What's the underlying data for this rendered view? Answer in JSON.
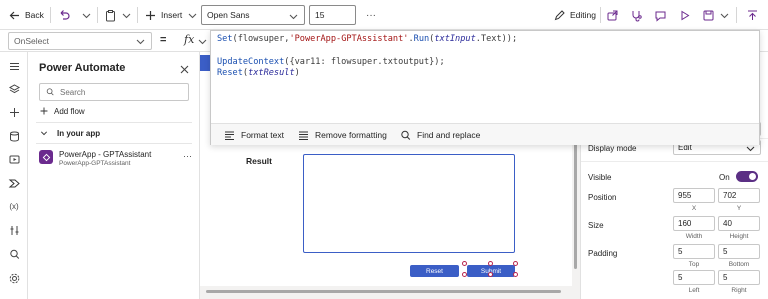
{
  "toolbar": {
    "back_label": "Back",
    "insert_label": "Insert",
    "font_value": "Open Sans",
    "font_size_value": "15",
    "more_label": "···",
    "editing_label": "Editing"
  },
  "formula_bar": {
    "property_value": "OnSelect",
    "equals": "=",
    "fx": "fx"
  },
  "editor": {
    "lines": [
      [
        {
          "t": "Set",
          "c": "fn"
        },
        {
          "t": "(flowsuper,"
        },
        {
          "t": "'PowerApp-GPTAssistant'",
          "c": "str"
        },
        {
          "t": "."
        },
        {
          "t": "Run",
          "c": "fn"
        },
        {
          "t": "("
        },
        {
          "t": "txtInput",
          "c": "var"
        },
        {
          "t": ".Text));"
        }
      ],
      [],
      [
        {
          "t": "UpdateContext",
          "c": "fn"
        },
        {
          "t": "({var11: flowsuper.txtoutput});"
        }
      ],
      [
        {
          "t": "Reset",
          "c": "fn"
        },
        {
          "t": "("
        },
        {
          "t": "txtResult",
          "c": "var"
        },
        {
          "t": ")"
        }
      ]
    ],
    "format_text": "Format text",
    "remove_formatting": "Remove formatting",
    "find_replace": "Find and replace"
  },
  "left_panel": {
    "title": "Power Automate",
    "search_placeholder": "Search",
    "add_flow": "Add flow",
    "section": "In your app",
    "flows": [
      {
        "name": "PowerApp - GPTAssistant",
        "subtitle": "PowerApp-GPTAssistant"
      }
    ]
  },
  "canvas": {
    "result_label": "Result",
    "reset_button": "Reset",
    "submit_button": "Submit"
  },
  "right_panel": {
    "display_mode_label": "Display mode",
    "display_mode_value": "Edit",
    "visible_label": "Visible",
    "visible_value": "On",
    "position_label": "Position",
    "position_x": "955",
    "position_y": "702",
    "x_caption": "X",
    "y_caption": "Y",
    "size_label": "Size",
    "size_width": "160",
    "size_height": "40",
    "width_caption": "Width",
    "height_caption": "Height",
    "padding_label": "Padding",
    "padding_top": "5",
    "padding_bottom": "5",
    "padding_left": "5",
    "padding_right": "5",
    "top_caption": "Top",
    "bottom_caption": "Bottom",
    "left_caption": "Left",
    "right_caption": "Right"
  },
  "colors": {
    "accent": "#3b5ec6",
    "purple": "#6b2a8e",
    "toggle": "#5b2f84"
  }
}
